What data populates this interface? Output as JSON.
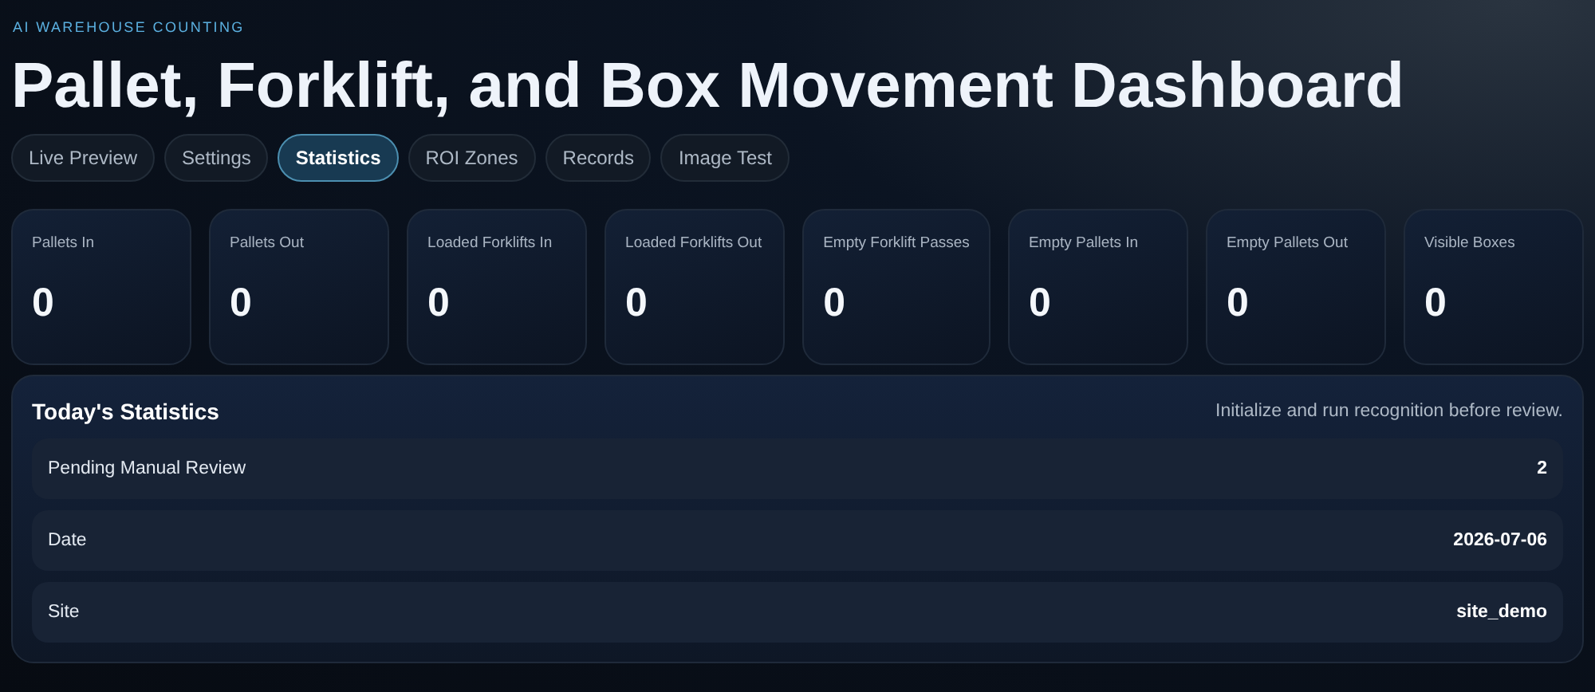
{
  "eyebrow": "AI WAREHOUSE COUNTING",
  "title": "Pallet, Forklift, and Box Movement Dashboard",
  "tabs": [
    {
      "label": "Live Preview",
      "selected": false
    },
    {
      "label": "Settings",
      "selected": false
    },
    {
      "label": "Statistics",
      "selected": true
    },
    {
      "label": "ROI Zones",
      "selected": false
    },
    {
      "label": "Records",
      "selected": false
    },
    {
      "label": "Image Test",
      "selected": false
    }
  ],
  "metrics": [
    {
      "label": "Pallets In",
      "value": "0"
    },
    {
      "label": "Pallets Out",
      "value": "0"
    },
    {
      "label": "Loaded Forklifts In",
      "value": "0"
    },
    {
      "label": "Loaded Forklifts Out",
      "value": "0"
    },
    {
      "label": "Empty Forklift Passes",
      "value": "0"
    },
    {
      "label": "Empty Pallets In",
      "value": "0"
    },
    {
      "label": "Empty Pallets Out",
      "value": "0"
    },
    {
      "label": "Visible Boxes",
      "value": "0"
    }
  ],
  "statistics": {
    "title": "Today's Statistics",
    "hint": "Initialize and run recognition before review.",
    "rows": [
      {
        "label": "Pending Manual Review",
        "value": "2"
      },
      {
        "label": "Date",
        "value": "2026-07-06"
      },
      {
        "label": "Site",
        "value": "site_demo"
      }
    ]
  }
}
